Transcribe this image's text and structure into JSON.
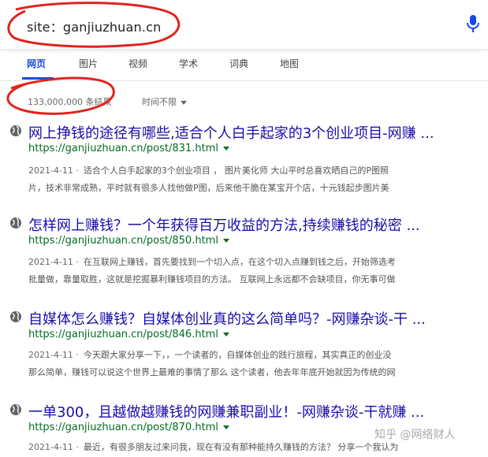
{
  "search": {
    "query": "site：ganjiuzhuan.cn"
  },
  "tabs": [
    {
      "label": "网页"
    },
    {
      "label": "图片"
    },
    {
      "label": "视频"
    },
    {
      "label": "学术"
    },
    {
      "label": "词典"
    },
    {
      "label": "地图"
    }
  ],
  "meta": {
    "count": "133,000,000 条结果",
    "time_filter": "时间不限"
  },
  "results": [
    {
      "title": "网上挣钱的途径有哪些,适合个人白手起家的3个创业项目-网赚 ...",
      "url": "https://ganjiuzhuan.cn/post/831.html",
      "date": "2021-4-11 ·",
      "line1": "适合个人白手起家的3个创业项目 ， 图片美化师 大山平时总喜欢晒自己的P图照",
      "line2": "片，技术非常成熟，平时就有很多人找他做P图，后来他干脆在某宝开个店，十元钱起步图片美"
    },
    {
      "title": "怎样网上赚钱？一个年获得百万收益的方法,持续赚钱的秘密 ...",
      "url": "https://ganjiuzhuan.cn/post/850.html",
      "date": "2021-4-11 ·",
      "line1": "在互联网上赚钱，首先要找到一个切入点，在这个切入点赚到钱之后，开始筛选考",
      "line2": "批量做，靠量取胜，这就是挖掘暴利赚钱项目的方法。 互联网上永远都不会缺项目，你无事可做"
    },
    {
      "title": "自媒体怎么赚钱？自媒体创业真的这么简单吗？-网赚杂谈-干 ...",
      "url": "https://ganjiuzhuan.cn/post/846.html",
      "date": "2021-4-11 ·",
      "line1": "今天跟大家分享一下，，一个读者的，自媒体创业的践行旅程，其实真正的创业没",
      "line2": "那么简单，赚钱可以说这个世界上最难的事情了那么 这个读者，他去年年底开始就因为传统的网"
    },
    {
      "title": "一单300，且越做越赚钱的网赚兼职副业！-网赚杂谈-干就赚 ...",
      "url": "https://ganjiuzhuan.cn/post/870.html",
      "date": "2021-4-11 ·",
      "line1": "最近，有很多朋友过来问我，现在有没有那种能持久赚钱的方法？ 分享一个我认为",
      "line2": ""
    }
  ],
  "watermark": "知乎 @网络财人",
  "colors": {
    "link": "#1a0dab",
    "url": "#006d21",
    "accent": "#174ae4",
    "scribble": "#e0231c"
  }
}
